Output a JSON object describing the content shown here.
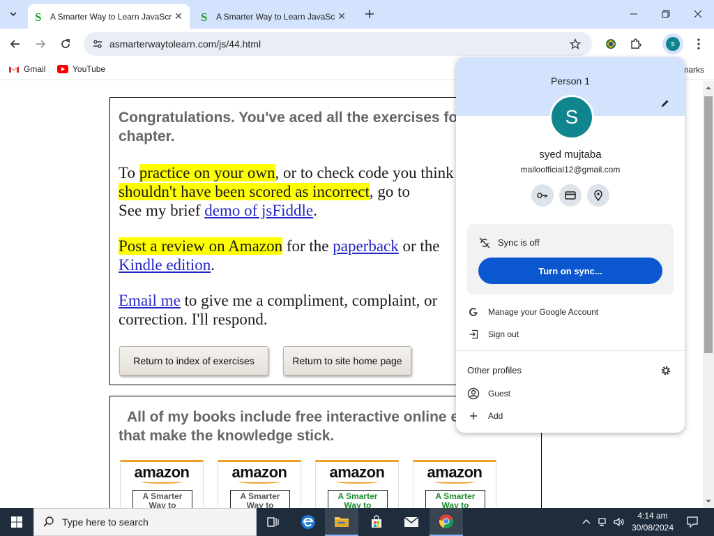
{
  "browser": {
    "tabs": [
      {
        "title": "A Smarter Way to Learn JavaScript",
        "active": true
      },
      {
        "title": "A Smarter Way to Learn JavaScript",
        "active": false
      }
    ],
    "url": "asmarterwaytolearn.com/js/44.html",
    "bookmarks": [
      {
        "label": "Gmail"
      },
      {
        "label": "YouTube"
      }
    ],
    "bookmarks_overflow_label": "All Bookmarks"
  },
  "page": {
    "heading": "Congratulations. You've aced all the exercises for this chapter.",
    "para1": {
      "pre": "To ",
      "hl1": "practice on your own",
      "mid": ", or to check code you think ",
      "hl2": "shouldn't have been scored as incorrect",
      "post": ", go to ",
      "line3_pre": "See my brief ",
      "link": "demo of jsFiddle",
      "line3_post": "."
    },
    "para2": {
      "hl": "Post a review on Amazon",
      "mid": " for the ",
      "link1": "paperback",
      "mid2": " or the",
      "link2": "Kindle edition",
      "post": "."
    },
    "para3": {
      "link": "Email me",
      "rest": " to give me a compliment, complaint, or",
      "line2": "correction. I'll respond."
    },
    "buttons": {
      "index": "Return to index of exercises",
      "home": "Return to site home page"
    },
    "books_heading": "All of my books include free interactive online exercises that make the knowledge stick.",
    "books": [
      {
        "brand": "amazon",
        "title": "A Smarter Way to"
      },
      {
        "brand": "amazon",
        "title": "A Smarter Way to"
      },
      {
        "brand": "amazon",
        "title": "A Smarter Way to"
      },
      {
        "brand": "amazon",
        "title": "A Smarter Way to"
      }
    ]
  },
  "profile_menu": {
    "person_label": "Person 1",
    "avatar_letter": "S",
    "name": "syed mujtaba",
    "email": "mailoofficial12@gmail.com",
    "sync_status": "Sync is off",
    "sync_button": "Turn on sync...",
    "manage_account": "Manage your Google Account",
    "sign_out": "Sign out",
    "other_profiles": "Other profiles",
    "guest": "Guest",
    "add": "Add",
    "colors": {
      "accent": "#0b57d0",
      "avatar": "#10858e",
      "header": "#d3e3fd"
    }
  },
  "taskbar": {
    "search_placeholder": "Type here to search",
    "time": "4:14 am",
    "date": "30/08/2024"
  }
}
